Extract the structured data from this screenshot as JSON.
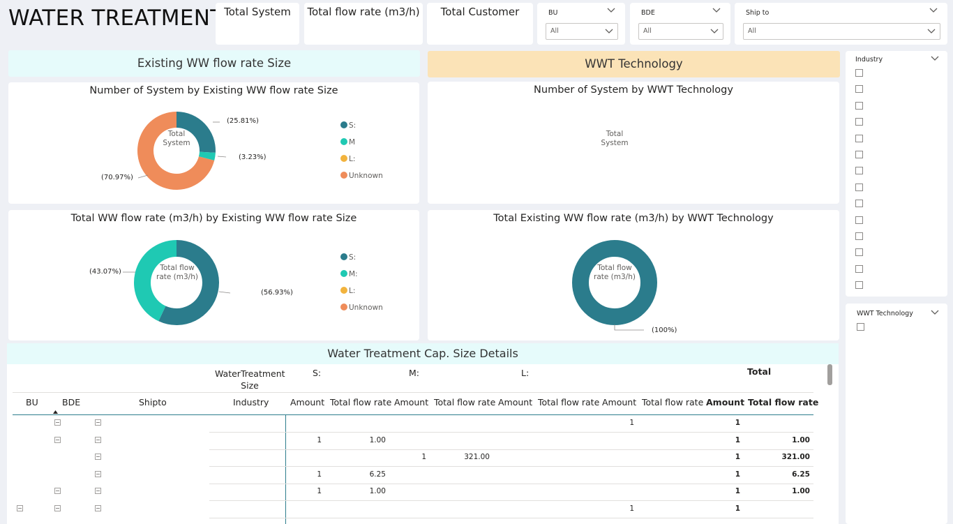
{
  "header": {
    "title": "WATER TREATMENT",
    "kpis": [
      "Total System",
      "Total flow rate (m3/h)",
      "Total Customer"
    ]
  },
  "slicers": {
    "bu": {
      "label": "BU",
      "value": "All"
    },
    "bde": {
      "label": "BDE",
      "value": "All"
    },
    "ship_to": {
      "label": "Ship to",
      "value": "All"
    },
    "industry": {
      "label": "Industry",
      "options_count": 14
    },
    "wwt_technology": {
      "label": "WWT Technology",
      "options_count": 1
    }
  },
  "sections": {
    "left": "Existing WW flow rate Size",
    "right": "WWT Technology",
    "details": "Water Treatment Cap. Size Details"
  },
  "colors": {
    "teal_dark": "#2b7c8c",
    "teal_light": "#1fc9b3",
    "amber": "#f2b33d",
    "orange": "#ef8c5a",
    "left_head_bg": "#e6fbfb",
    "right_head_bg": "#fbe3b7"
  },
  "legend": {
    "items": [
      "S:",
      "M",
      "L:",
      "Unknown"
    ],
    "items_bottom": [
      "S:",
      "M:",
      "L:",
      "Unknown"
    ]
  },
  "charts": {
    "donut1": {
      "title": "Number of System by Existing WW flow rate Size",
      "center": "Total System",
      "labels": [
        "(25.81%)",
        "(3.23%)",
        "(70.97%)"
      ]
    },
    "donut2": {
      "title": "Number of System by WWT Technology",
      "center": "Total System"
    },
    "donut3": {
      "title": "Total WW flow rate (m3/h) by Existing WW flow rate Size",
      "center": "Total flow rate (m3/h)",
      "labels": [
        "(43.07%)",
        "(56.93%)"
      ]
    },
    "donut4": {
      "title": "Total Existing WW flow rate (m3/h) by WWT Technology",
      "center": "Total flow rate (m3/h)",
      "labels": [
        "(100%)"
      ]
    }
  },
  "chart_data": [
    {
      "type": "pie",
      "title": "Number of System by Existing WW flow rate Size",
      "categories": [
        "S:",
        "M",
        "L:",
        "Unknown"
      ],
      "values": [
        25.81,
        3.23,
        0,
        70.97
      ]
    },
    {
      "type": "pie",
      "title": "Total WW flow rate (m3/h) by Existing WW flow rate Size",
      "categories": [
        "S:",
        "M:",
        "L:",
        "Unknown"
      ],
      "values": [
        56.93,
        43.07,
        0,
        0
      ]
    },
    {
      "type": "pie",
      "title": "Total Existing WW flow rate (m3/h) by WWT Technology",
      "categories": [
        ""
      ],
      "values": [
        100
      ]
    }
  ],
  "matrix": {
    "column_group_label": "WaterTreatment Size",
    "groups": [
      "S:",
      "M:",
      "L:",
      "",
      "Total"
    ],
    "row_headers": [
      "BU",
      "BDE",
      "Shipto",
      "Industry"
    ],
    "measure_headers": [
      "Amount",
      "Total flow rate"
    ],
    "rows": [
      {
        "s_amt": "",
        "s_flow": "",
        "m_amt": "",
        "m_flow": "",
        "l_amt": "",
        "l_flow": "",
        "u_amt": "1",
        "u_flow": "",
        "t_amt": "1",
        "t_flow": ""
      },
      {
        "s_amt": "1",
        "s_flow": "1.00",
        "m_amt": "",
        "m_flow": "",
        "l_amt": "",
        "l_flow": "",
        "u_amt": "",
        "u_flow": "",
        "t_amt": "1",
        "t_flow": "1.00"
      },
      {
        "s_amt": "",
        "s_flow": "",
        "m_amt": "1",
        "m_flow": "321.00",
        "l_amt": "",
        "l_flow": "",
        "u_amt": "",
        "u_flow": "",
        "t_amt": "1",
        "t_flow": "321.00"
      },
      {
        "s_amt": "1",
        "s_flow": "6.25",
        "m_amt": "",
        "m_flow": "",
        "l_amt": "",
        "l_flow": "",
        "u_amt": "",
        "u_flow": "",
        "t_amt": "1",
        "t_flow": "6.25"
      },
      {
        "s_amt": "1",
        "s_flow": "1.00",
        "m_amt": "",
        "m_flow": "",
        "l_amt": "",
        "l_flow": "",
        "u_amt": "",
        "u_flow": "",
        "t_amt": "1",
        "t_flow": "1.00"
      },
      {
        "s_amt": "",
        "s_flow": "",
        "m_amt": "",
        "m_flow": "",
        "l_amt": "",
        "l_flow": "",
        "u_amt": "1",
        "u_flow": "",
        "t_amt": "1",
        "t_flow": ""
      }
    ]
  }
}
